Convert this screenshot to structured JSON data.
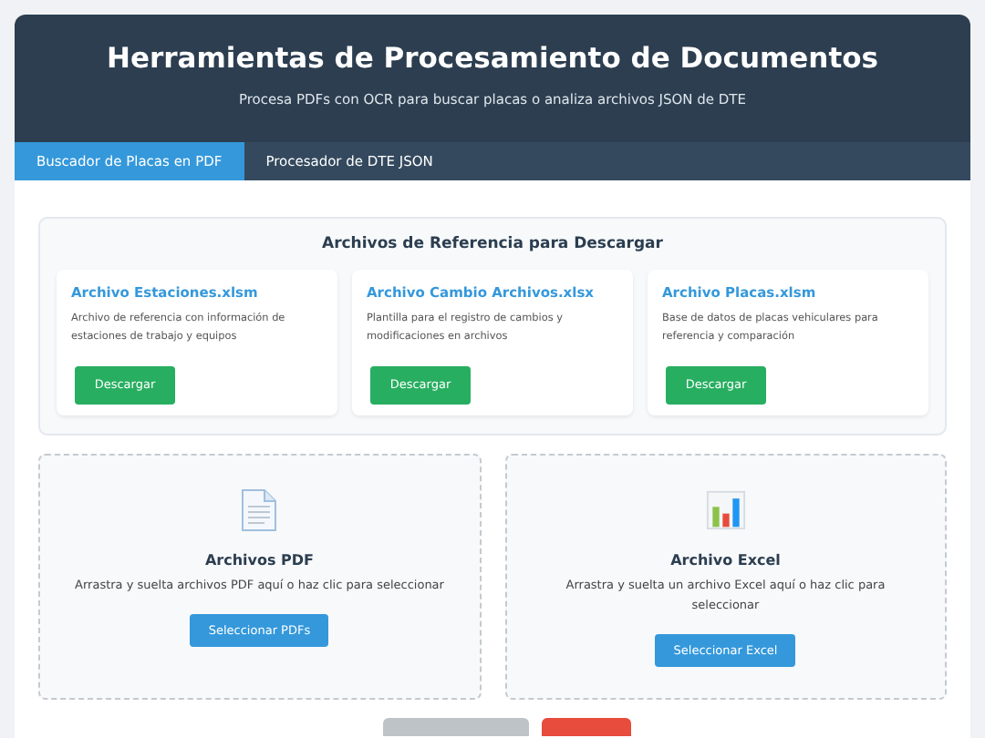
{
  "header": {
    "title": "Herramientas de Procesamiento de Documentos",
    "subtitle": "Procesa PDFs con OCR para buscar placas o analiza archivos JSON de DTE"
  },
  "tabs": [
    {
      "label": "Buscador de Placas en PDF",
      "selected": true
    },
    {
      "label": "Procesador de DTE JSON",
      "selected": false
    }
  ],
  "reference_files": {
    "title": "Archivos de Referencia para Descargar",
    "files": [
      {
        "name": "Archivo Estaciones.xlsm",
        "description": "Archivo de referencia con información de estaciones de trabajo y equipos",
        "button": "Descargar"
      },
      {
        "name": "Archivo Cambio Archivos.xlsx",
        "description": "Plantilla para el registro de cambios y modificaciones en archivos",
        "button": "Descargar"
      },
      {
        "name": "Archivo Placas.xlsm",
        "description": "Base de datos de placas vehiculares para referencia y comparación",
        "button": "Descargar"
      }
    ]
  },
  "upload_zones": [
    {
      "kind": "pdf",
      "title": "Archivos PDF",
      "hint": "Arrastra y suelta archivos PDF aquí o haz clic para seleccionar",
      "button": "Seleccionar PDFs"
    },
    {
      "kind": "excel",
      "title": "Archivo Excel",
      "hint": "Arrastra y suelta un archivo Excel aquí o haz clic para seleccionar",
      "button": "Seleccionar Excel"
    }
  ],
  "actions": [
    {
      "kind": "secondary"
    },
    {
      "kind": "danger"
    }
  ]
}
